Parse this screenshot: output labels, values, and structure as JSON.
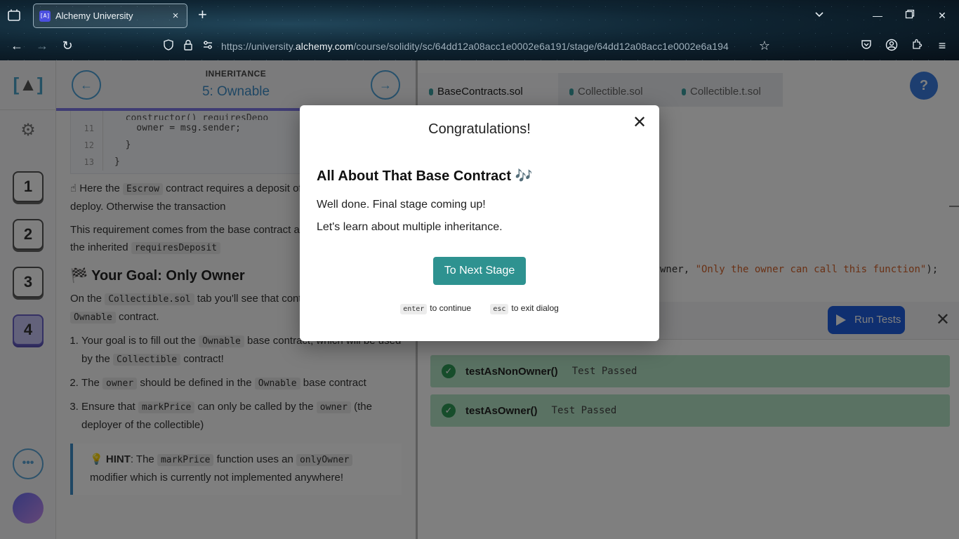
{
  "browser": {
    "tab_title": "Alchemy University",
    "tab_favicon": "[A]",
    "url_prefix": "https://university.",
    "url_host": "alchemy.com",
    "url_path": "/course/solidity/sc/64dd12a08acc1e0002e6a191/stage/64dd12a08acc1e0002e6a194"
  },
  "rail": {
    "logo": "[A]",
    "stages": [
      "1",
      "2",
      "3",
      "4"
    ],
    "current_stage": "4",
    "more": "•••"
  },
  "lesson": {
    "category": "INHERITANCE",
    "title": "5: Ownable",
    "progress_percent": 68,
    "code_lines": [
      {
        "n": "11",
        "t": "    owner = msg.sender;"
      },
      {
        "n": "12",
        "t": "  }"
      },
      {
        "n": "13",
        "t": "}"
      }
    ],
    "para1_pre": "☝ Here the ",
    "para1_code": "Escrow",
    "para1_post": " contract requires a deposit of ether in order to deploy. Otherwise the transaction",
    "para2_pre": "This requirement comes from the base contract and is used through the inherited ",
    "para2_code": "requiresDeposit",
    "goal_title": "🏁 Your Goal: Only Owner",
    "para3_pre": "On the ",
    "para3_code1": "Collectible.sol",
    "para3_mid": " tab you'll see that contract inherits from the ",
    "para3_code2": "Ownable",
    "para3_post": " contract.",
    "items": [
      {
        "pre": "Your goal is to fill out the ",
        "code": "Ownable",
        "mid": " base contract, which will be used by the ",
        "code2": "Collectible",
        "post": " contract!"
      },
      {
        "pre": "The ",
        "code": "owner",
        "mid": " should be defined in the ",
        "code2": "Ownable",
        "post": " base contract"
      },
      {
        "pre": "Ensure that ",
        "code": "markPrice",
        "mid": " can only be called by the ",
        "code2": "owner",
        "post": " (the deployer of the collectible)"
      }
    ],
    "hint_label": "HINT",
    "hint_pre": ": The ",
    "hint_code1": "markPrice",
    "hint_mid": " function uses an ",
    "hint_code2": "onlyOwner",
    "hint_post": " modifier which is currently not implemented anywhere!"
  },
  "editor": {
    "tabs": [
      "BaseContracts.sol",
      "Collectible.sol",
      "Collectible.t.sol"
    ],
    "help_label": "?",
    "snippet_pre": "wner, ",
    "snippet_str": "\"Only the owner can call this function\"",
    "snippet_post": ");",
    "run_label": "Run Tests",
    "close_label": "✕",
    "tests": [
      {
        "name": "testAsNonOwner()",
        "status": "Test Passed"
      },
      {
        "name": "testAsOwner()",
        "status": "Test Passed"
      }
    ]
  },
  "modal": {
    "heading": "Congratulations!",
    "close": "✕",
    "title": "All About That Base Contract 🎶",
    "line1": "Well done. Final stage coming up!",
    "line2": "Let's learn about multiple inheritance.",
    "button": "To Next Stage",
    "enter_key": "enter",
    "enter_text": "to continue",
    "esc_key": "esc",
    "esc_text": "to exit dialog"
  }
}
